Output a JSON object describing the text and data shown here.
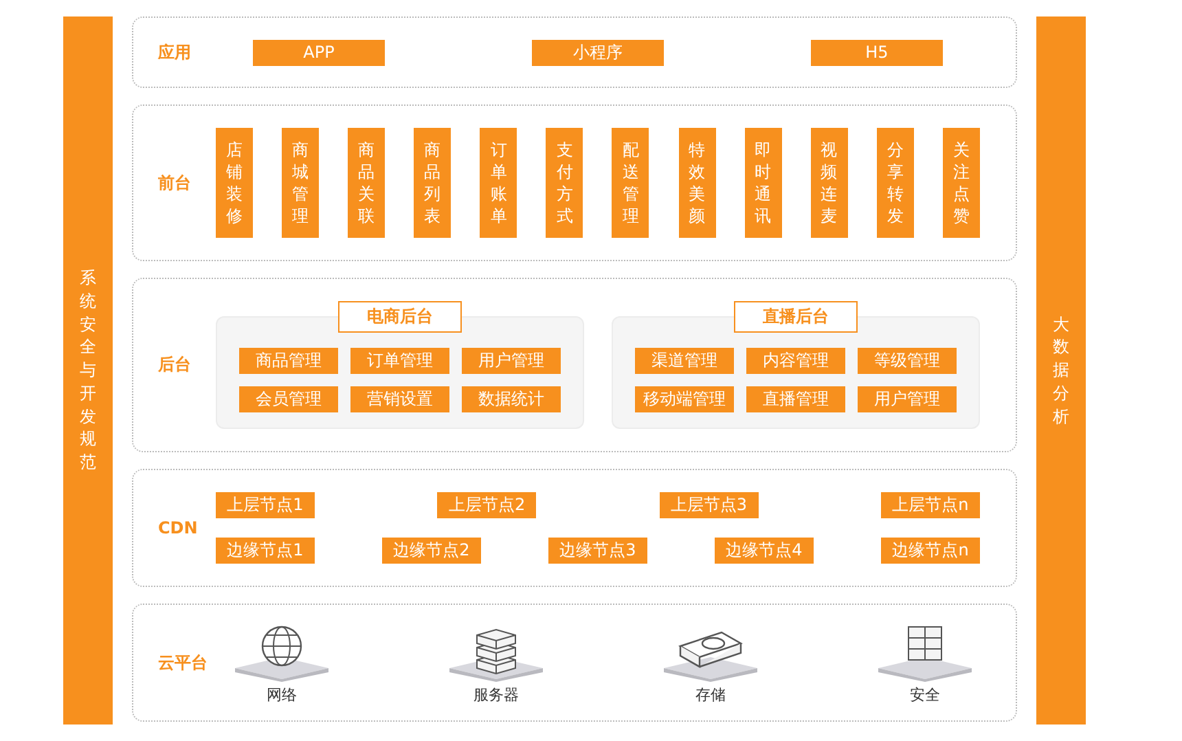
{
  "left_bar": {
    "label": "系统安全与开发规范"
  },
  "right_bar": {
    "label": "大数据分析"
  },
  "layers": [
    {
      "kind": "apps",
      "label": "应用",
      "items": [
        "APP",
        "小程序",
        "H5"
      ]
    },
    {
      "kind": "vertical",
      "label": "前台",
      "items": [
        "店铺装修",
        "商城管理",
        "商品关联",
        "商品列表",
        "订单账单",
        "支付方式",
        "配送管理",
        "特效美颜",
        "即时通讯",
        "视频连麦",
        "分享转发",
        "关注点赞"
      ]
    },
    {
      "kind": "panels",
      "label": "后台",
      "panels": [
        {
          "title": "电商后台",
          "items": [
            "商品管理",
            "订单管理",
            "用户管理",
            "会员管理",
            "营销设置",
            "数据统计"
          ]
        },
        {
          "title": "直播后台",
          "items": [
            "渠道管理",
            "内容管理",
            "等级管理",
            "移动端管理",
            "直播管理",
            "用户管理"
          ]
        }
      ]
    },
    {
      "kind": "rows",
      "label": "CDN",
      "upper_nodes": [
        "上层节点1",
        "上层节点2",
        "上层节点3",
        "上层节点n"
      ],
      "edge_nodes": [
        "边缘节点1",
        "边缘节点2",
        "边缘节点3",
        "边缘节点4",
        "边缘节点n"
      ]
    },
    {
      "kind": "icons",
      "label": "云平台",
      "items": [
        {
          "kind": "globe",
          "label": "网络"
        },
        {
          "kind": "server",
          "label": "服务器"
        },
        {
          "kind": "disk",
          "label": "存储"
        },
        {
          "kind": "wall",
          "label": "安全"
        }
      ]
    }
  ]
}
